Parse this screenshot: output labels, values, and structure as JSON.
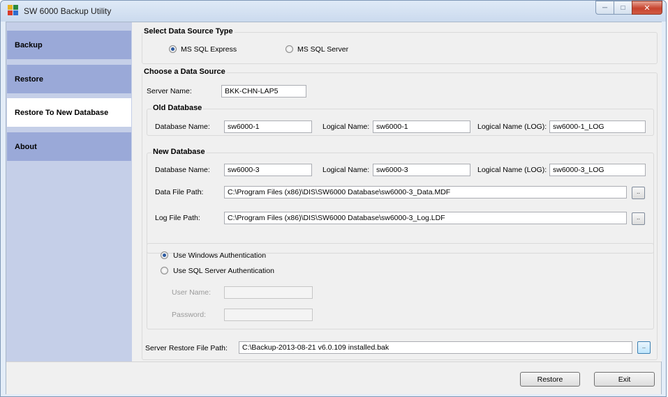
{
  "window": {
    "title": "SW 6000 Backup Utility",
    "controls": {
      "minimize": "─",
      "maximize": "□",
      "close": "✕"
    }
  },
  "sidebar": {
    "items": [
      {
        "label": "Backup"
      },
      {
        "label": "Restore"
      },
      {
        "label": "Restore To New Database",
        "active": true
      },
      {
        "label": "About"
      }
    ]
  },
  "source_type": {
    "title": "Select Data Source Type",
    "options": [
      "MS SQL Express",
      "MS SQL Server"
    ],
    "selected": "MS SQL Express"
  },
  "data_source": {
    "title": "Choose a Data Source",
    "server_name_label": "Server Name:",
    "server_name": "BKK-CHN-LAP5"
  },
  "old_db": {
    "title": "Old Database",
    "db_name_label": "Database Name:",
    "db_name": "sw6000-1",
    "logical_label": "Logical Name:",
    "logical": "sw6000-1",
    "logical_log_label": "Logical Name (LOG):",
    "logical_log": "sw6000-1_LOG"
  },
  "new_db": {
    "title": "New Database",
    "db_name_label": "Database Name:",
    "db_name": "sw6000-3",
    "logical_label": "Logical Name:",
    "logical": "sw6000-3",
    "logical_log_label": "Logical Name (LOG):",
    "logical_log": "sw6000-3_LOG",
    "data_path_label": "Data File Path:",
    "data_path": "C:\\Program Files (x86)\\DIS\\SW6000 Database\\sw6000-3_Data.MDF",
    "log_path_label": "Log File Path:",
    "log_path": "C:\\Program Files (x86)\\DIS\\SW6000 Database\\sw6000-3_Log.LDF",
    "browse": ".."
  },
  "auth": {
    "windows_label": "Use Windows Authentication",
    "sql_label": "Use SQL Server Authentication",
    "selected": "windows",
    "user_label": "User Name:",
    "user": "",
    "password_label": "Password:",
    "password": ""
  },
  "restore_file": {
    "label": "Server Restore File Path:",
    "path": "C:\\Backup-2013-08-21 v6.0.109 installed.bak",
    "browse": ".."
  },
  "buttons": {
    "restore": "Restore",
    "exit": "Exit"
  }
}
